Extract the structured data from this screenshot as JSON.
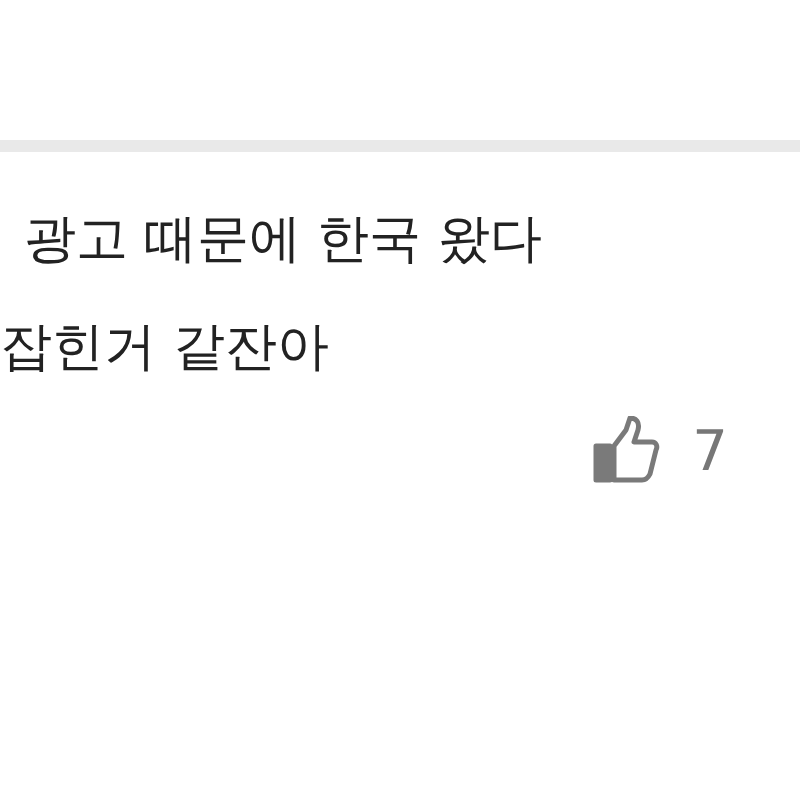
{
  "comment": {
    "lines": [
      "광고 때문에 한국 왔다",
      "잡힌거 같잔아"
    ],
    "likes": "7"
  }
}
